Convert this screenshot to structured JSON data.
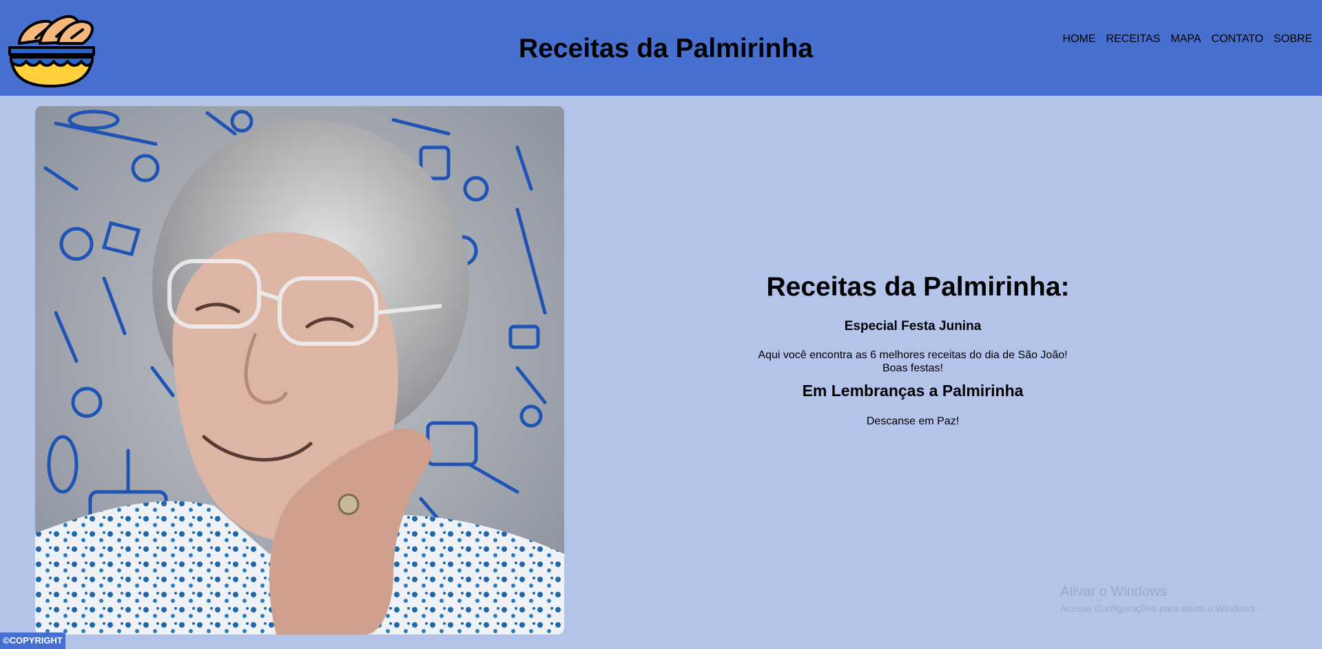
{
  "header": {
    "title": "Receitas da Palmirinha",
    "logo_icon": "bread-basket-icon",
    "nav": [
      "HOME",
      "RECEITAS",
      "MAPA",
      "CONTATO",
      "SOBRE"
    ]
  },
  "main": {
    "photo": "portrait-photo",
    "headline": "Receitas da Palmirinha:",
    "subhead": "Especial Festa Junina",
    "intro_line1": "Aqui você encontra as 6 melhores receitas do dia de São João!",
    "intro_line2": "Boas festas!",
    "memorial": "Em Lembranças a Palmirinha",
    "farewell": "Descanse em Paz!"
  },
  "watermark": {
    "title": "Ativar o Windows",
    "subtitle": "Acesse Configurações para ativar o Windows."
  },
  "footer": {
    "copyright": "©COPYRIGHT"
  },
  "colors": {
    "header_bg": "#466fd0",
    "page_bg": "#b3c3ea",
    "doodle_blue": "#1f54b5"
  }
}
